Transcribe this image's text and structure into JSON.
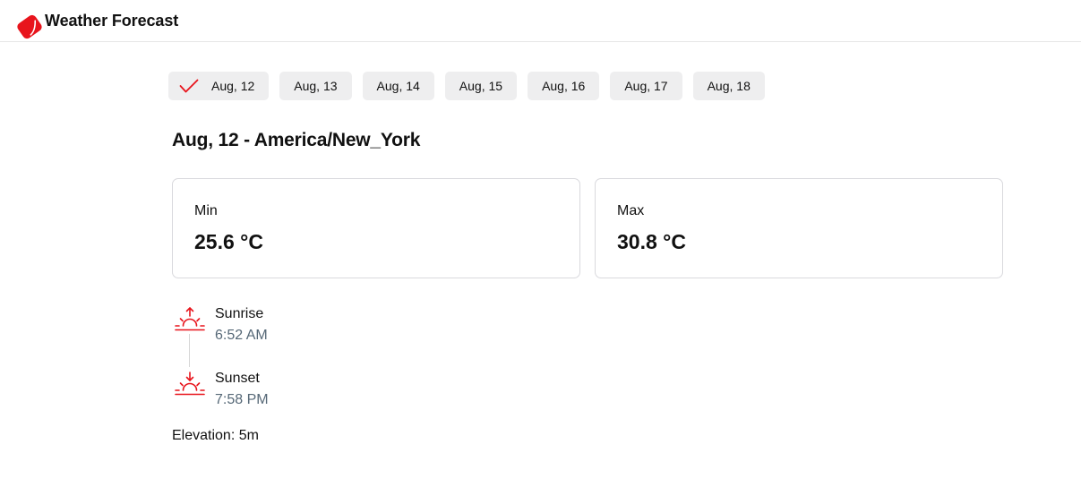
{
  "header": {
    "title": "Weather Forecast",
    "logo_icon": "logo-icon"
  },
  "colors": {
    "accent": "#e8141c",
    "muted_text": "#566877",
    "tab_bg": "#eeeeef"
  },
  "tabs": [
    {
      "label": "Aug, 12",
      "selected": true
    },
    {
      "label": "Aug, 13",
      "selected": false
    },
    {
      "label": "Aug, 14",
      "selected": false
    },
    {
      "label": "Aug, 15",
      "selected": false
    },
    {
      "label": "Aug, 16",
      "selected": false
    },
    {
      "label": "Aug, 17",
      "selected": false
    },
    {
      "label": "Aug, 18",
      "selected": false
    }
  ],
  "main": {
    "heading": "Aug, 12 - America/New_York",
    "min": {
      "label": "Min",
      "value": "25.6 °C"
    },
    "max": {
      "label": "Max",
      "value": "30.8 °C"
    },
    "sunrise": {
      "label": "Sunrise",
      "time": "6:52 AM",
      "icon": "sunrise-icon"
    },
    "sunset": {
      "label": "Sunset",
      "time": "7:58 PM",
      "icon": "sunset-icon"
    },
    "elevation": "Elevation: 5m"
  }
}
